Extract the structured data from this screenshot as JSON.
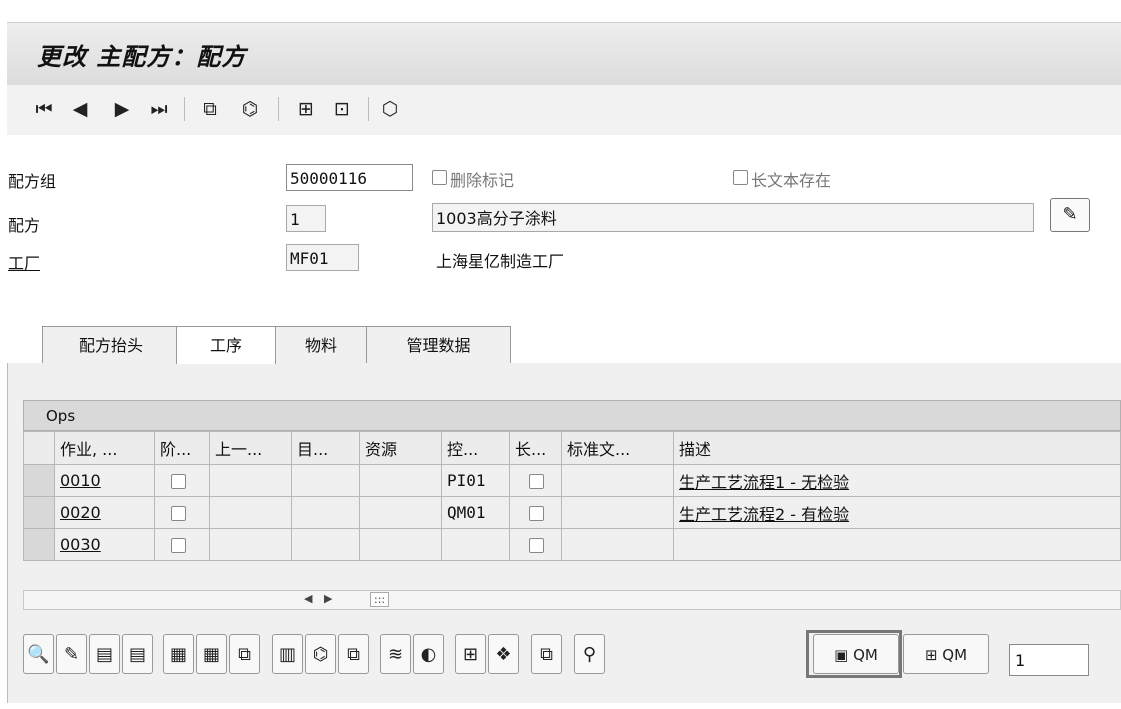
{
  "title": "更改 主配方：配方",
  "toolbar": {
    "first_icon": "⏮",
    "prev_icon": "◀",
    "next_icon": "▶",
    "last_icon": "⏭",
    "icon5": "⧉",
    "icon6": "⌬",
    "icon7": "⊞",
    "icon8": "⊡",
    "icon9": "⬡"
  },
  "header": {
    "recipe_group_label": "配方组",
    "recipe_group_value": "50000116",
    "delete_flag_label": "删除标记",
    "long_text_label": "长文本存在",
    "recipe_label": "配方",
    "recipe_value": "1",
    "recipe_desc": "1003高分子涂料",
    "plant_label": "工厂",
    "plant_value": "MF01",
    "plant_desc": "上海星亿制造工厂",
    "edit_icon": "✎"
  },
  "tabs": [
    {
      "label": "配方抬头"
    },
    {
      "label": "工序"
    },
    {
      "label": "物料"
    },
    {
      "label": "管理数据"
    }
  ],
  "grid": {
    "title": "Ops",
    "columns": [
      "作业, ...",
      "阶...",
      "上一...",
      "目...",
      "资源",
      "控...",
      "长...",
      "标准文...",
      "描述"
    ],
    "rows": [
      {
        "op": "0010",
        "ctrl": "PI01",
        "desc": "生产工艺流程1 - 无检验"
      },
      {
        "op": "0020",
        "ctrl": "QM01",
        "desc": "生产工艺流程2 - 有检验"
      },
      {
        "op": "0030",
        "ctrl": "",
        "desc": ""
      }
    ],
    "scroll_left": "◀",
    "scroll_right": "▶",
    "scroll_thumb": ":::"
  },
  "buttons": {
    "icons": [
      "🔍",
      "✎",
      "▤",
      "▤",
      "▦",
      "▦",
      "⧉",
      "▥",
      "⌬",
      "⧉",
      "≋",
      "◐",
      "⊞",
      "❖",
      "⧉",
      "⚲"
    ],
    "qm1_icon": "▣",
    "qm1_label": "QM",
    "qm2_icon": "⊞",
    "qm2_label": "QM",
    "page_value": "1"
  }
}
